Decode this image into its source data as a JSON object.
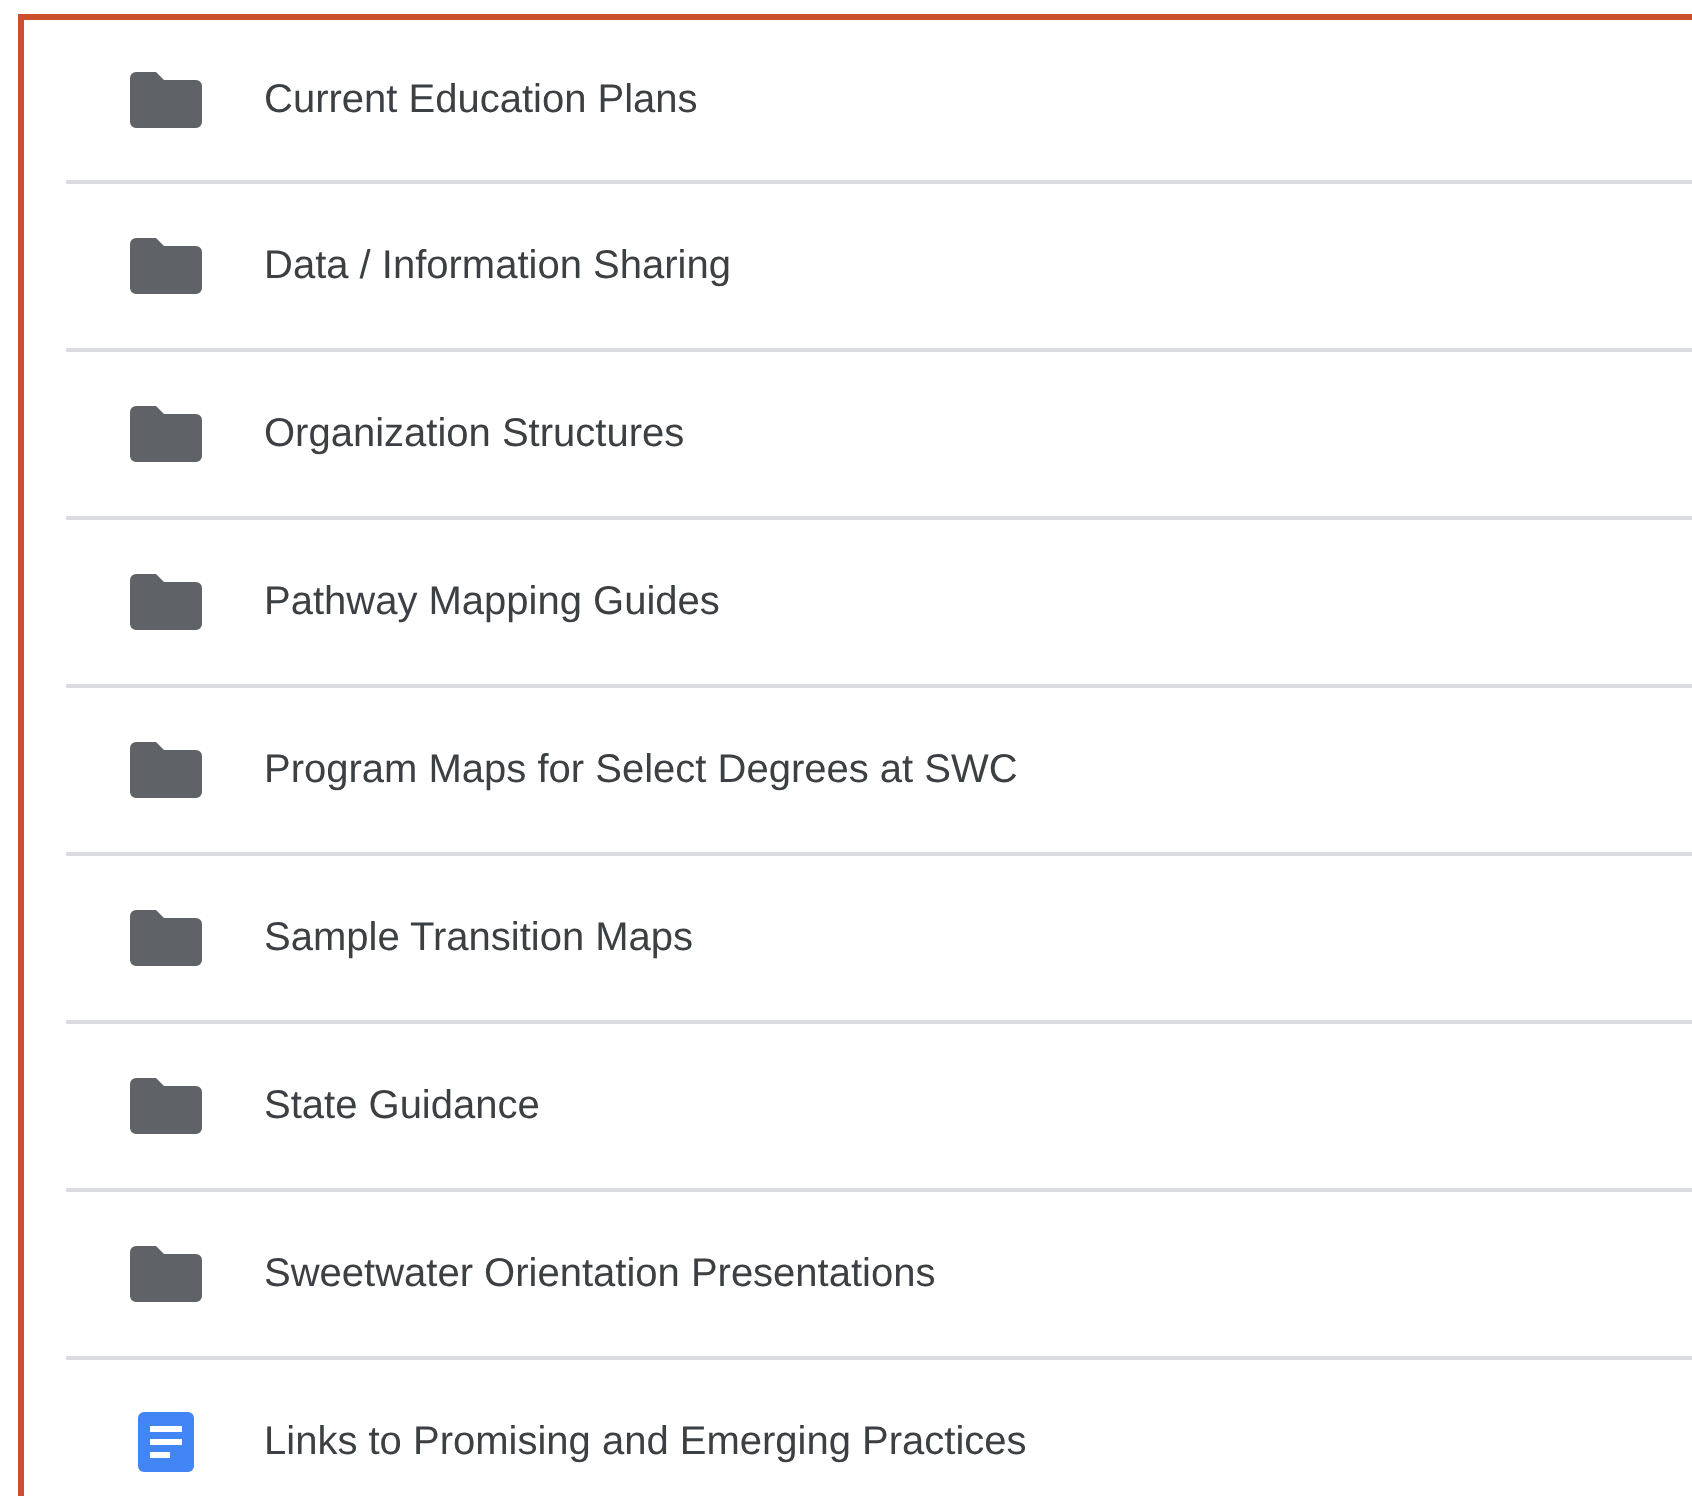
{
  "files": [
    {
      "kind": "folder",
      "name": "Current Education Plans"
    },
    {
      "kind": "folder",
      "name": "Data / Information Sharing"
    },
    {
      "kind": "folder",
      "name": "Organization Structures"
    },
    {
      "kind": "folder",
      "name": "Pathway Mapping Guides"
    },
    {
      "kind": "folder",
      "name": "Program Maps for Select Degrees at SWC"
    },
    {
      "kind": "folder",
      "name": "Sample Transition Maps"
    },
    {
      "kind": "folder",
      "name": "State Guidance"
    },
    {
      "kind": "folder",
      "name": "Sweetwater Orientation Presentations"
    },
    {
      "kind": "doc",
      "name": "Links to Promising and Emerging Practices"
    }
  ]
}
